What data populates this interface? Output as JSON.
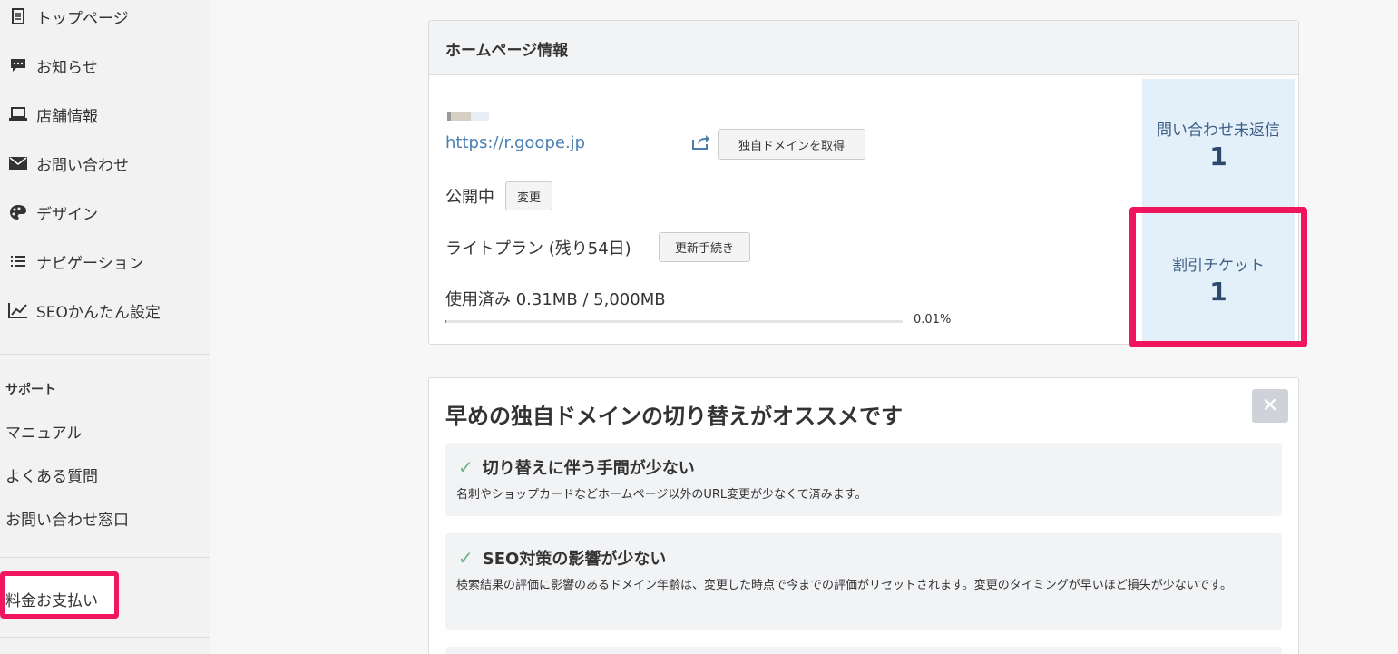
{
  "sidebar": {
    "nav_items": [
      {
        "label": "トップページ",
        "icon": "document-icon"
      },
      {
        "label": "お知らせ",
        "icon": "chat-icon"
      },
      {
        "label": "店舗情報",
        "icon": "laptop-icon"
      },
      {
        "label": "お問い合わせ",
        "icon": "mail-icon"
      },
      {
        "label": "デザイン",
        "icon": "palette-icon"
      },
      {
        "label": "ナビゲーション",
        "icon": "list-icon"
      },
      {
        "label": "SEOかんたん設定",
        "icon": "chart-line-icon"
      }
    ],
    "support_title": "サポート",
    "support_links": [
      "マニュアル",
      "よくある質問",
      "お問い合わせ窓口"
    ],
    "payment_label": "料金お支払い"
  },
  "info": {
    "title": "ホームページ情報",
    "url": "https://r.goope.jp",
    "domain_button": "独自ドメインを取得",
    "status": "公開中",
    "status_button": "変更",
    "plan": "ライトプラン (残り54日)",
    "plan_button": "更新手続き",
    "usage": "使用済み 0.31MB / 5,000MB",
    "usage_percent": "0.01%",
    "usage_fraction": 0.0001,
    "stats": [
      {
        "label": "問い合わせ未返信",
        "value": "1"
      },
      {
        "label": "割引チケット",
        "value": "1"
      }
    ]
  },
  "recommendation": {
    "title": "早めの独自ドメインの切り替えがオススメです",
    "close_symbol": "✕",
    "cards": [
      {
        "title": "切り替えに伴う手間が少ない",
        "desc": "名刺やショップカードなどホームページ以外のURL変更が少なくて済みます。"
      },
      {
        "title": "SEO対策の影響が少ない",
        "desc": "検索結果の評価に影響のあるドメイン年齢は、変更した時点で今までの評価がリセットされます。変更のタイミングが早いほど損失が少ないです。"
      }
    ]
  },
  "colors": {
    "accent_highlight": "#f0165d",
    "link": "#4a7fb0",
    "stat_bg": "#e3eff9",
    "check": "#6fb387"
  }
}
